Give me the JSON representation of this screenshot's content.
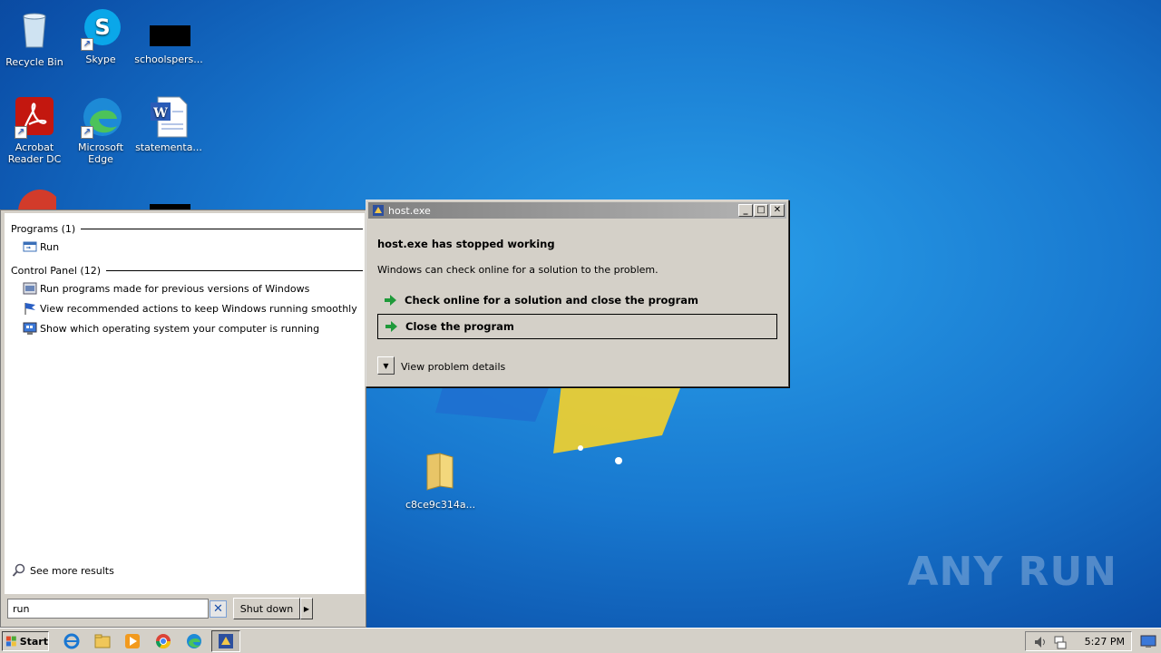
{
  "desktop": {
    "icons": [
      {
        "label": "Recycle Bin",
        "icon": "recycle-bin-icon"
      },
      {
        "label": "Skype",
        "icon": "skype-icon"
      },
      {
        "label": "schoolspers...",
        "icon": "black-thumbnail-icon"
      },
      {
        "label": "Acrobat Reader DC",
        "icon": "acrobat-reader-icon"
      },
      {
        "label": "Microsoft Edge",
        "icon": "edge-icon"
      },
      {
        "label": "statementa...",
        "icon": "word-document-icon"
      },
      {
        "label": "c8ce9c314a...",
        "icon": "folder-icon"
      }
    ],
    "watermark": "ANY RUN"
  },
  "start_menu": {
    "groups": [
      {
        "header": "Programs (1)",
        "items": [
          {
            "label": "Run",
            "icon": "run-icon"
          }
        ]
      },
      {
        "header": "Control Panel (12)",
        "items": [
          {
            "label": "Run programs made for previous versions of Windows",
            "icon": "compatibility-icon"
          },
          {
            "label": "View recommended actions to keep Windows running smoothly",
            "icon": "action-center-flag-icon"
          },
          {
            "label": "Show which operating system your computer is running",
            "icon": "system-info-icon"
          }
        ]
      }
    ],
    "see_more": "See more results",
    "search_value": "run",
    "shutdown_label": "Shut down"
  },
  "dialog": {
    "title": "host.exe",
    "heading": "host.exe has stopped working",
    "message": "Windows can check online for a solution to the problem.",
    "options": [
      {
        "label": "Check online for a solution and close the program",
        "focused": false
      },
      {
        "label": "Close the program",
        "focused": true
      }
    ],
    "details_label": "View problem details"
  },
  "taskbar": {
    "start_label": "Start",
    "pinned": [
      "internet-explorer-icon",
      "file-explorer-icon",
      "media-player-icon",
      "chrome-icon",
      "edge-icon",
      "host-exe-taskbar-icon"
    ],
    "tray_icons": [
      "volume-icon",
      "network-icon",
      "action-center-icon"
    ],
    "clock": "5:27 PM"
  }
}
